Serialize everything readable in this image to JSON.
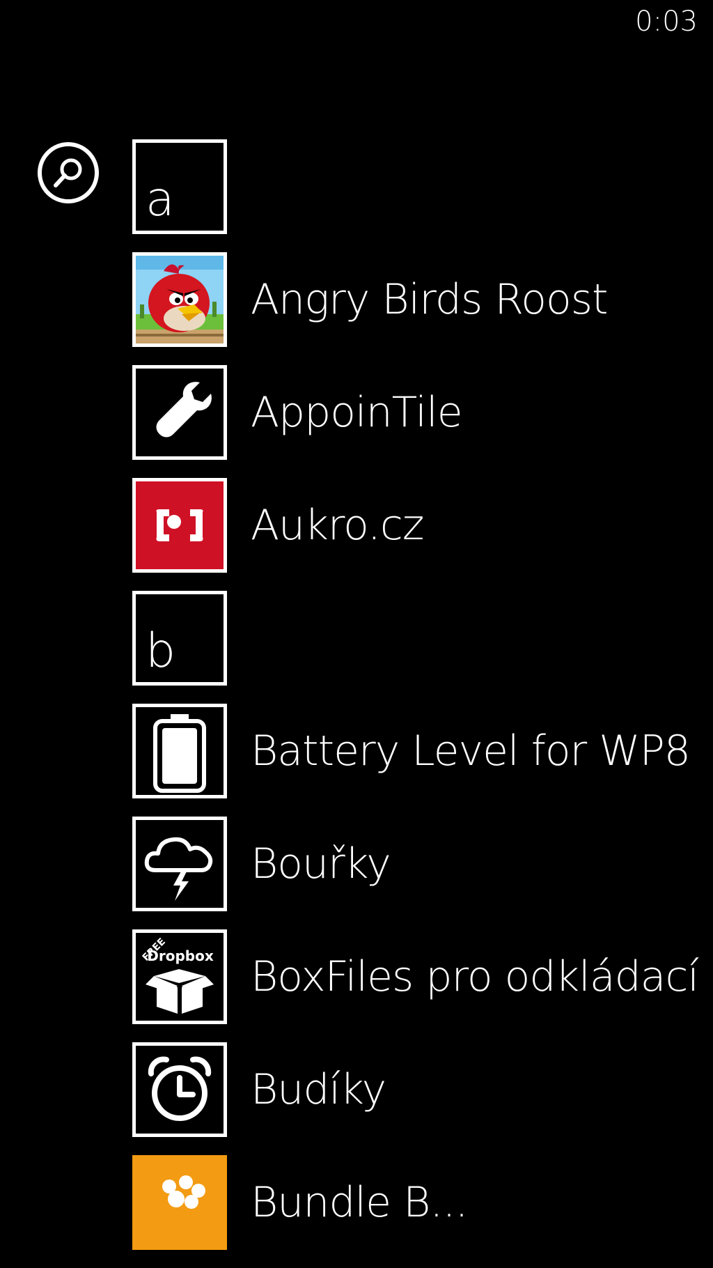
{
  "status_bar": {
    "time": "0:03"
  },
  "search": {
    "icon": "search-icon"
  },
  "items": [
    {
      "type": "header",
      "letter": "a"
    },
    {
      "type": "app",
      "name": "Angry Birds Roost",
      "icon": "angry-bird-icon"
    },
    {
      "type": "app",
      "name": "AppoinTile",
      "icon": "wrench-icon"
    },
    {
      "type": "app",
      "name": "Aukro.cz",
      "icon": "aukro-logo-icon",
      "tile_color": "#cf1126"
    },
    {
      "type": "header",
      "letter": "b"
    },
    {
      "type": "app",
      "name": "Battery Level for WP8",
      "icon": "battery-icon"
    },
    {
      "type": "app",
      "name": "Bouřky",
      "icon": "storm-cloud-icon"
    },
    {
      "type": "app",
      "name": "BoxFiles pro odkládací",
      "icon": "dropbox-box-icon",
      "tile_text": "Dropbox",
      "tile_badge": "FREE"
    },
    {
      "type": "app",
      "name": "Budíky",
      "icon": "alarm-clock-icon"
    },
    {
      "type": "app",
      "name": "Bundle B...",
      "icon": "bundle-icon",
      "tile_color": "#f39b12"
    }
  ]
}
